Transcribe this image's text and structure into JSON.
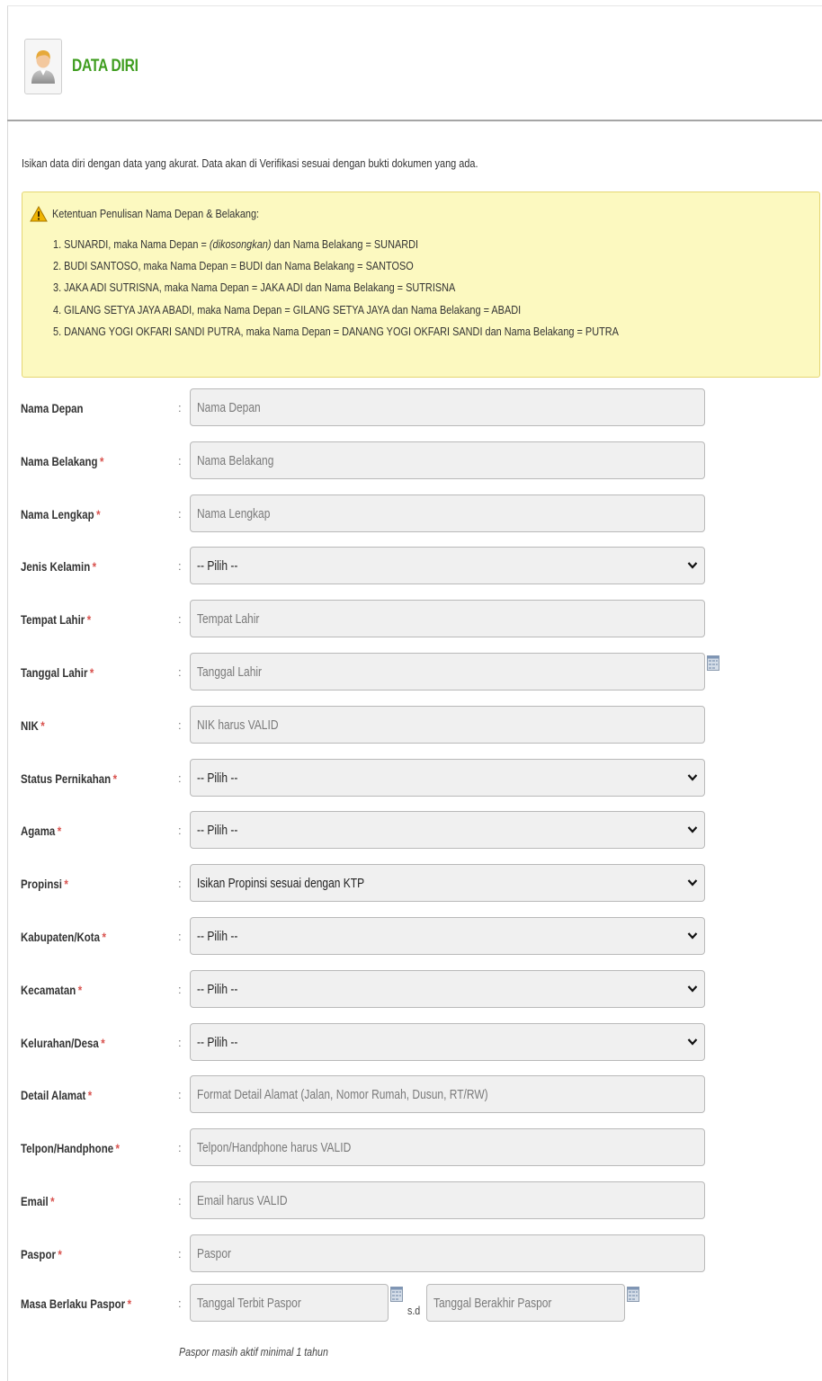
{
  "header": {
    "title": "DATA DIRI",
    "icon": "user-icon"
  },
  "intro": "Isikan data diri dengan data yang akurat. Data akan di Verifikasi sesuai dengan bukti dokumen yang ada.",
  "notice": {
    "title": "Ketentuan Penulisan Nama Depan & Belakang:",
    "items": [
      {
        "pre": "1. SUNARDI, maka Nama Depan = ",
        "em": "(dikosongkan)",
        "post": " dan Nama Belakang = SUNARDI"
      },
      {
        "pre": "2. BUDI SANTOSO, maka Nama Depan = BUDI dan Nama Belakang = SANTOSO",
        "em": "",
        "post": ""
      },
      {
        "pre": "3. JAKA ADI SUTRISNA, maka Nama Depan = JAKA ADI dan Nama Belakang = SUTRISNA",
        "em": "",
        "post": ""
      },
      {
        "pre": "4. GILANG SETYA JAYA ABADI, maka Nama Depan = GILANG SETYA JAYA dan Nama Belakang = ABADI",
        "em": "",
        "post": ""
      },
      {
        "pre": "5. DANANG YOGI OKFARI SANDI PUTRA, maka Nama Depan = DANANG YOGI OKFARI SANDI dan Nama Belakang = PUTRA",
        "em": "",
        "post": ""
      }
    ]
  },
  "form": {
    "colon": ":",
    "required_mark": "*",
    "fields": [
      {
        "label": "Nama Depan",
        "required": false,
        "type": "input",
        "placeholder": "Nama Depan"
      },
      {
        "label": "Nama Belakang",
        "required": true,
        "type": "input",
        "placeholder": "Nama Belakang"
      },
      {
        "label": "Nama Lengkap",
        "required": true,
        "type": "input",
        "placeholder": "Nama Lengkap"
      },
      {
        "label": "Jenis Kelamin",
        "required": true,
        "type": "select",
        "value": "-- Pilih --"
      },
      {
        "label": "Tempat Lahir",
        "required": true,
        "type": "input",
        "placeholder": "Tempat Lahir"
      },
      {
        "label": "Tanggal Lahir",
        "required": true,
        "type": "date",
        "placeholder": "Tanggal Lahir"
      },
      {
        "label": "NIK",
        "required": true,
        "type": "input",
        "placeholder": "NIK harus VALID"
      },
      {
        "label": "Status Pernikahan",
        "required": true,
        "type": "select",
        "value": "-- Pilih --"
      },
      {
        "label": "Agama",
        "required": true,
        "type": "select",
        "value": "-- Pilih --"
      },
      {
        "label": "Propinsi",
        "required": true,
        "type": "select",
        "value": "Isikan Propinsi sesuai dengan KTP"
      },
      {
        "label": "Kabupaten/Kota",
        "required": true,
        "type": "select",
        "value": "-- Pilih --"
      },
      {
        "label": "Kecamatan",
        "required": true,
        "type": "select",
        "value": "-- Pilih --"
      },
      {
        "label": "Kelurahan/Desa",
        "required": true,
        "type": "select",
        "value": "-- Pilih --"
      },
      {
        "label": "Detail Alamat",
        "required": true,
        "type": "input",
        "placeholder": "Format Detail Alamat (Jalan, Nomor Rumah, Dusun, RT/RW)"
      },
      {
        "label": "Telpon/Handphone",
        "required": true,
        "type": "input",
        "placeholder": "Telpon/Handphone harus VALID"
      },
      {
        "label": "Email",
        "required": true,
        "type": "input",
        "placeholder": "Email harus VALID"
      },
      {
        "label": "Paspor",
        "required": true,
        "type": "input",
        "placeholder": "Paspor"
      }
    ],
    "passport_validity": {
      "label": "Masa Berlaku Paspor",
      "required": true,
      "start_placeholder": "Tanggal Terbit Paspor",
      "separator": "s.d",
      "end_placeholder": "Tanggal Berakhir Paspor",
      "hint": "Paspor masih aktif minimal 1 tahun"
    }
  }
}
